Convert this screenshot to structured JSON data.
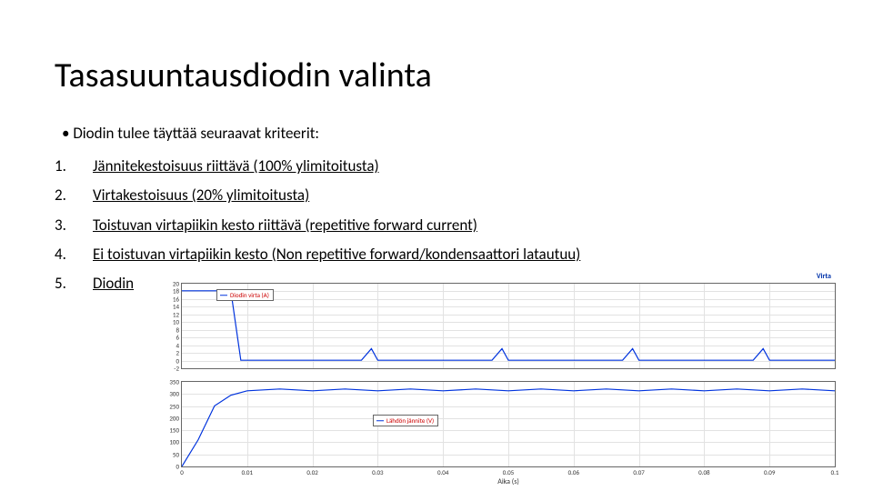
{
  "title": "Tasasuuntausdiodin valinta",
  "intro": "Diodin tulee täyttää seuraavat kriteerit:",
  "criteria": [
    "Jännitekestoisuus riittävä (100% ylimitoitusta)",
    "Virtakestoisuus (20% ylimitoitusta)",
    "Toistuvan virtapiikin kesto riittävä (repetitive forward current)",
    "Ei toistuvan virtapiikin kesto (Non repetitive forward/kondensaattori latautuu)",
    "Diodin"
  ],
  "chart_data": [
    {
      "type": "line",
      "title": "",
      "legend_label": "Diodin virta (A)",
      "xlabel": "",
      "ylabel": "",
      "x": [
        0,
        0.005,
        0.01,
        0.015,
        0.02,
        0.025,
        0.03,
        0.035,
        0.04,
        0.045,
        0.05,
        0.055,
        0.06,
        0.065,
        0.07,
        0.075,
        0.08,
        0.085,
        0.09,
        0.095,
        0.1
      ],
      "series": [
        {
          "name": "Diodin virta",
          "values": [
            18,
            18,
            0,
            0,
            0,
            0,
            3,
            0,
            0,
            0,
            3,
            0,
            0,
            0,
            3,
            0,
            0,
            0,
            3,
            0,
            0
          ]
        }
      ],
      "ylim": [
        -2,
        20
      ],
      "yticks": [
        -2,
        0,
        2,
        4,
        6,
        8,
        10,
        12,
        14,
        16,
        18,
        20
      ],
      "xlim": [
        0,
        0.1
      ],
      "xticks": []
    },
    {
      "type": "line",
      "title": "",
      "legend_label": "Lähdön jännite (V)",
      "xlabel": "Aika (s)",
      "ylabel": "",
      "x": [
        0,
        0.005,
        0.01,
        0.015,
        0.02,
        0.03,
        0.04,
        0.05,
        0.06,
        0.07,
        0.08,
        0.09,
        0.1
      ],
      "series": [
        {
          "name": "Lähdön jännite",
          "values": [
            0,
            250,
            310,
            320,
            323,
            320,
            323,
            320,
            323,
            320,
            323,
            320,
            323
          ]
        }
      ],
      "ylim": [
        0,
        350
      ],
      "yticks": [
        0,
        50,
        100,
        150,
        200,
        250,
        300,
        350
      ],
      "xlim": [
        0,
        0.1
      ],
      "xticks": [
        0,
        0.01,
        0.02,
        0.03,
        0.04,
        0.05,
        0.06,
        0.07,
        0.08,
        0.09,
        0.1
      ]
    }
  ],
  "chart_header": "Virta"
}
